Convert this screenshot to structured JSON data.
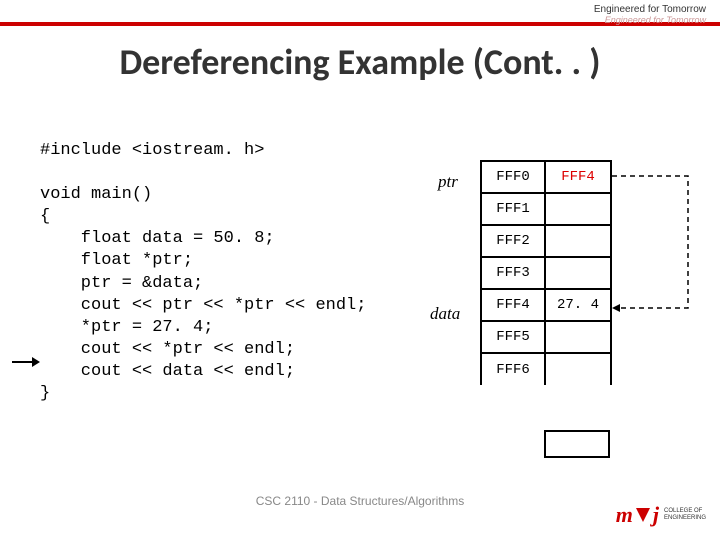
{
  "header": {
    "tagline1": "Engineered for Tomorrow",
    "tagline2": "Engineered for Tomorrow"
  },
  "title": "Dereferencing Example (Cont. . )",
  "code": "#include <iostream. h>\n\nvoid main()\n{\n    float data = 50. 8;\n    float *ptr;\n    ptr = &data;\n    cout << ptr << *ptr << endl;\n    *ptr = 27. 4;\n    cout << *ptr << endl;\n    cout << data << endl;\n}",
  "labels": {
    "ptr": "ptr",
    "data": "data"
  },
  "memory": {
    "rows": [
      {
        "addr": "FFF0",
        "val": "FFF4",
        "val_red": true
      },
      {
        "addr": "FFF1",
        "val": ""
      },
      {
        "addr": "FFF2",
        "val": ""
      },
      {
        "addr": "FFF3",
        "val": ""
      },
      {
        "addr": "FFF4",
        "val": "27. 4"
      },
      {
        "addr": "FFF5",
        "val": ""
      },
      {
        "addr": "FFF6",
        "val": ""
      }
    ]
  },
  "footer": "CSC 2110 - Data Structures/Algorithms",
  "logo": {
    "text_m": "m",
    "text_j": "j",
    "sub1": "COLLEGE OF",
    "sub2": "ENGINEERING"
  }
}
